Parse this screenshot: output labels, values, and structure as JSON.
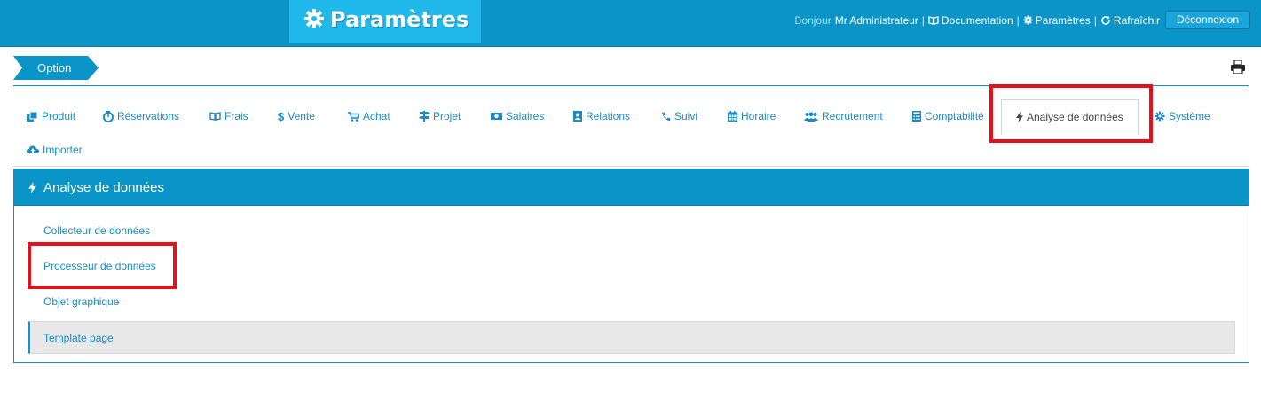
{
  "header": {
    "title": "Paramètres",
    "greeting": "Bonjour",
    "user": "Mr Administrateur",
    "links": [
      {
        "icon": "book-icon",
        "label": "Documentation"
      },
      {
        "icon": "gear-icon",
        "label": "Paramètres"
      },
      {
        "icon": "refresh-icon",
        "label": "Rafraîchir"
      }
    ],
    "logout_label": "Déconnexion"
  },
  "option": {
    "label": "Option",
    "print_icon": "print-icon"
  },
  "tabs": [
    {
      "label": "Produit",
      "icon": "cubes-icon"
    },
    {
      "label": "Réservations",
      "icon": "timer-icon"
    },
    {
      "label": "Frais",
      "icon": "open-book-icon"
    },
    {
      "label": "Vente",
      "icon": "dollar-icon"
    },
    {
      "label": "Achat",
      "icon": "cart-icon"
    },
    {
      "label": "Projet",
      "icon": "signpost-icon"
    },
    {
      "label": "Salaires",
      "icon": "money-icon"
    },
    {
      "label": "Relations",
      "icon": "address-book-icon"
    },
    {
      "label": "Suivi",
      "icon": "phone-icon"
    },
    {
      "label": "Horaire",
      "icon": "calendar-icon"
    },
    {
      "label": "Recrutement",
      "icon": "users-icon"
    },
    {
      "label": "Comptabilité",
      "icon": "calculator-icon"
    },
    {
      "label": "Analyse de données",
      "icon": "bolt-icon",
      "active": true
    },
    {
      "label": "Système",
      "icon": "gear-icon"
    },
    {
      "label": "Importer",
      "icon": "cloud-upload-icon"
    }
  ],
  "panel": {
    "title": "Analyse de données",
    "items": [
      {
        "label": "Collecteur de données"
      },
      {
        "label": "Processeur de données"
      },
      {
        "label": "Objet graphique"
      },
      {
        "label": "Template page",
        "selected": true
      }
    ]
  },
  "colors": {
    "accent": "#0a94c8",
    "accent_light": "#21b9ec",
    "link": "#1a8bc4",
    "highlight": "#e5101a"
  }
}
